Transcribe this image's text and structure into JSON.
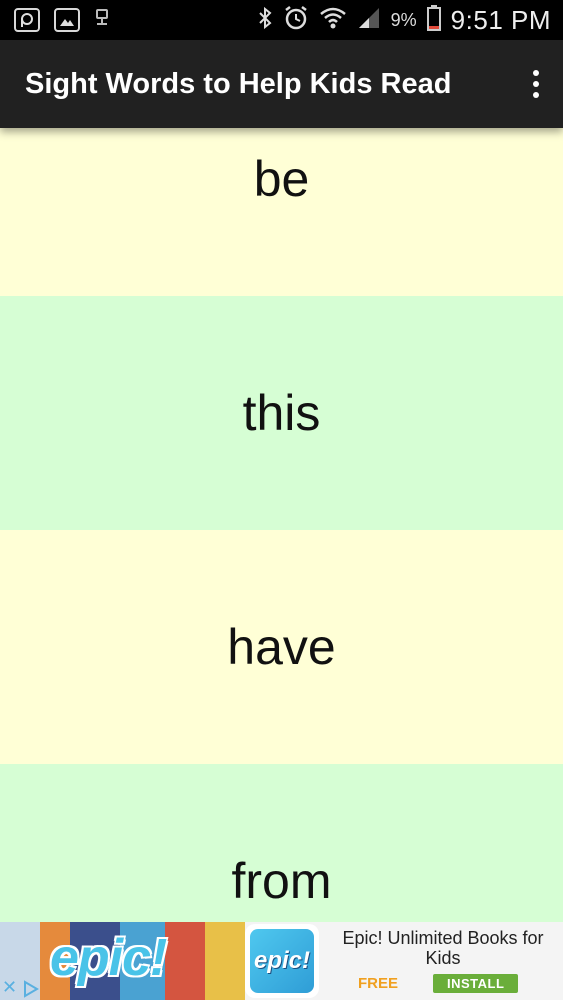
{
  "status_bar": {
    "time": "9:51 PM",
    "battery_pct": "9%",
    "icons": [
      "pocket-icon",
      "gallery-icon",
      "usb-debug-icon",
      "bluetooth-icon",
      "alarm-icon",
      "wifi-icon",
      "signal-icon",
      "battery-icon"
    ]
  },
  "app_bar": {
    "title": "Sight Words to Help Kids Read",
    "menu_icon": "overflow-menu-icon"
  },
  "words": [
    {
      "text": "be",
      "color": "#FFFFD6"
    },
    {
      "text": "this",
      "color": "#D6FED4"
    },
    {
      "text": "have",
      "color": "#FFFFD6"
    },
    {
      "text": "from",
      "color": "#D6FED4"
    }
  ],
  "ad": {
    "brand_art": "epic!",
    "logo_text": "epic!",
    "headline": "Epic! Unlimited Books for Kids",
    "price": "FREE",
    "cta": "INSTALL",
    "colors": {
      "price": "#F0A020",
      "cta": "#6AAE3A"
    }
  }
}
